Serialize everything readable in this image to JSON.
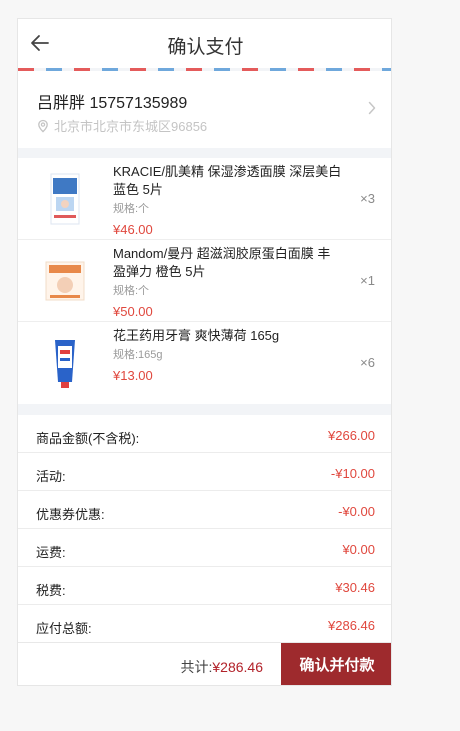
{
  "header": {
    "title": "确认支付"
  },
  "address": {
    "name_phone": "吕胖胖 15757135989",
    "location": "北京市北京市东城区96856"
  },
  "items": [
    {
      "name": "KRACIE/肌美精 保湿渗透面膜 深层美白 蓝色 5片",
      "spec": "规格:个",
      "price": "¥46.00",
      "qty": "×3",
      "thumb_color": "#3f79c4"
    },
    {
      "name": "Mandom/曼丹 超滋润胶原蛋白面膜 丰盈弹力 橙色 5片",
      "spec": "规格:个",
      "price": "¥50.00",
      "qty": "×1",
      "thumb_color": "#e8894a"
    },
    {
      "name": "花王药用牙膏 爽快薄荷 165g",
      "spec": "规格:165g",
      "price": "¥13.00",
      "qty": "×6",
      "thumb_color": "#2a63c9"
    }
  ],
  "summary": [
    {
      "label": "商品金额(不含税):",
      "value": "¥266.00"
    },
    {
      "label": "活动:",
      "value": "-¥10.00"
    },
    {
      "label": "优惠券优惠:",
      "value": "-¥0.00"
    },
    {
      "label": "运费:",
      "value": "¥0.00"
    },
    {
      "label": "税费:",
      "value": "¥30.46"
    },
    {
      "label": "应付总额:",
      "value": "¥286.46"
    }
  ],
  "footer": {
    "total_label": "共计:",
    "total_amount": "¥286.46",
    "pay_button": "确认并付款"
  },
  "colors": {
    "accent": "#9e2a2d",
    "price": "#e0483e"
  }
}
